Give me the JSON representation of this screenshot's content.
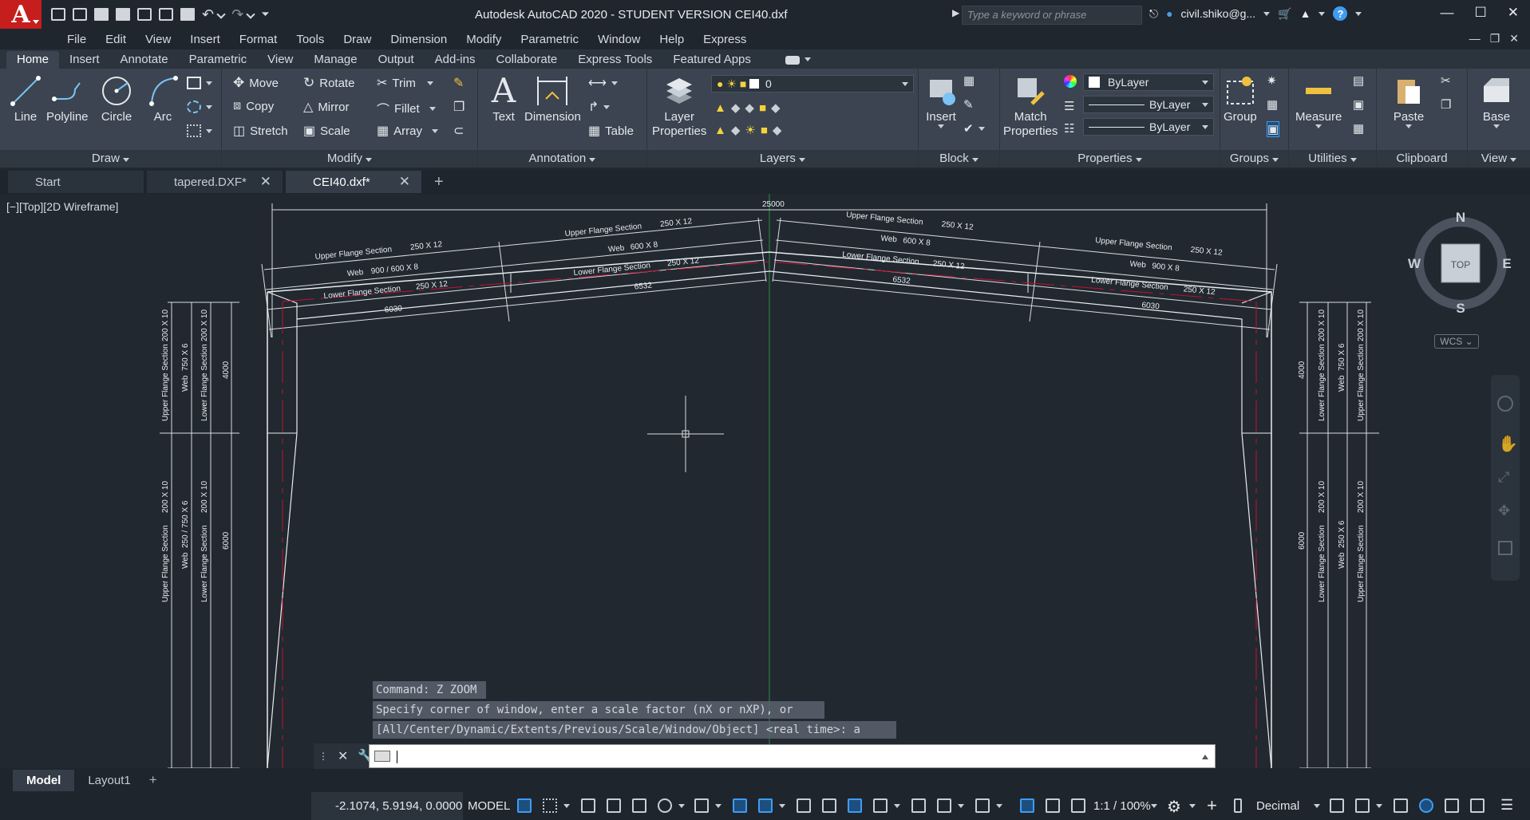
{
  "app": {
    "title": "Autodesk AutoCAD 2020 - STUDENT VERSION    CEI40.dxf",
    "search_placeholder": "Type a keyword or phrase",
    "user": "civil.shiko@g...",
    "logo_letter": "A"
  },
  "menu": [
    "File",
    "Edit",
    "View",
    "Insert",
    "Format",
    "Tools",
    "Draw",
    "Dimension",
    "Modify",
    "Parametric",
    "Window",
    "Help",
    "Express"
  ],
  "ribbon_tabs": [
    "Home",
    "Insert",
    "Annotate",
    "Parametric",
    "View",
    "Manage",
    "Output",
    "Add-ins",
    "Collaborate",
    "Express Tools",
    "Featured Apps"
  ],
  "ribbon": {
    "draw": {
      "title": "Draw",
      "line": "Line",
      "polyline": "Polyline",
      "circle": "Circle",
      "arc": "Arc"
    },
    "modify": {
      "title": "Modify",
      "move": "Move",
      "rotate": "Rotate",
      "trim": "Trim",
      "copy": "Copy",
      "mirror": "Mirror",
      "fillet": "Fillet",
      "stretch": "Stretch",
      "scale": "Scale",
      "array": "Array"
    },
    "annotation": {
      "title": "Annotation",
      "text": "Text",
      "dimension": "Dimension",
      "table": "Table"
    },
    "layers": {
      "title": "Layers",
      "layer_properties_1": "Layer",
      "layer_properties_2": "Properties",
      "current_layer": "0"
    },
    "block": {
      "title": "Block",
      "insert": "Insert"
    },
    "properties": {
      "title": "Properties",
      "match_1": "Match",
      "match_2": "Properties",
      "color": "ByLayer",
      "linetype": "ByLayer",
      "lineweight": "ByLayer"
    },
    "groups": {
      "title": "Groups",
      "group": "Group"
    },
    "utilities": {
      "title": "Utilities",
      "measure": "Measure"
    },
    "clipboard": {
      "title": "Clipboard",
      "paste": "Paste"
    },
    "view": {
      "title": "View",
      "base": "Base"
    }
  },
  "doc_tabs": [
    {
      "label": "Start"
    },
    {
      "label": "tapered.DXF*"
    },
    {
      "label": "CEI40.dxf*"
    }
  ],
  "viewport_label": "[−][Top][2D Wireframe]",
  "viewcube": {
    "n": "N",
    "s": "S",
    "e": "E",
    "w": "W",
    "top": "TOP",
    "wcs": "WCS ⌄"
  },
  "drawing": {
    "overall_dim": "25000",
    "left_upper": [
      {
        "a": "Upper Flange Section",
        "b": "250 X 12"
      },
      {
        "a": "Web",
        "b": "900 / 600 X 8"
      },
      {
        "a": "Lower Flange Section",
        "b": "250 X 12"
      },
      {
        "a": "6030",
        "b": ""
      }
    ],
    "left_mid": [
      {
        "a": "Upper Flange Section",
        "b": "250 X 12"
      },
      {
        "a": "Web",
        "b": "600 X 8"
      },
      {
        "a": "Lower Flange Section",
        "b": "250 X 12"
      },
      {
        "a": "6532",
        "b": ""
      }
    ],
    "right_mid": [
      {
        "a": "Upper Flange Section",
        "b": "250 X 12"
      },
      {
        "a": "Web",
        "b": "600 X 8"
      },
      {
        "a": "Lower Flange Section",
        "b": "250 X 12"
      },
      {
        "a": "6532",
        "b": ""
      }
    ],
    "right_outer": [
      {
        "a": "Upper Flange Section",
        "b": "250 X 12"
      },
      {
        "a": "Web",
        "b": "900 X 8"
      },
      {
        "a": "Lower Flange Section",
        "b": "250 X 12"
      },
      {
        "a": "6030",
        "b": ""
      }
    ],
    "col_left_top": [
      "200 X 10",
      "Upper Flange Section",
      "Web",
      "750 X 6",
      "200 X 10",
      "Lower Flange Section",
      "4000"
    ],
    "col_left_bot": [
      "200 X 10",
      "Upper Flange Section",
      "Web",
      "250 / 750 X 6",
      "200 X 10",
      "Lower Flange Section",
      "6000"
    ],
    "col_right_top": [
      "4000",
      "200 X 10",
      "Lower Flange Section",
      "Web",
      "750 X 6",
      "200 X 10",
      "Upper Flange Section"
    ],
    "col_right_bot": [
      "6000",
      "200 X 10",
      "Lower Flange Section",
      "Web",
      "250 X 6",
      "200 X 10",
      "Upper Flange Section"
    ]
  },
  "command": {
    "history": [
      "Command: Z ZOOM",
      "Specify corner of window, enter a scale factor (nX or nXP), or",
      "[All/Center/Dynamic/Extents/Previous/Scale/Window/Object] <real time>: a"
    ]
  },
  "layout_tabs": [
    "Model",
    "Layout1"
  ],
  "status": {
    "coords": "-2.1074, 5.9194, 0.0000",
    "model": "MODEL",
    "scale": "1:1 / 100%",
    "units": "Decimal"
  },
  "colors": {
    "accent": "#3f9cf0",
    "logo": "#c61d1d",
    "centerline": "#c8102e",
    "ucs_green": "#2e8b3e"
  }
}
